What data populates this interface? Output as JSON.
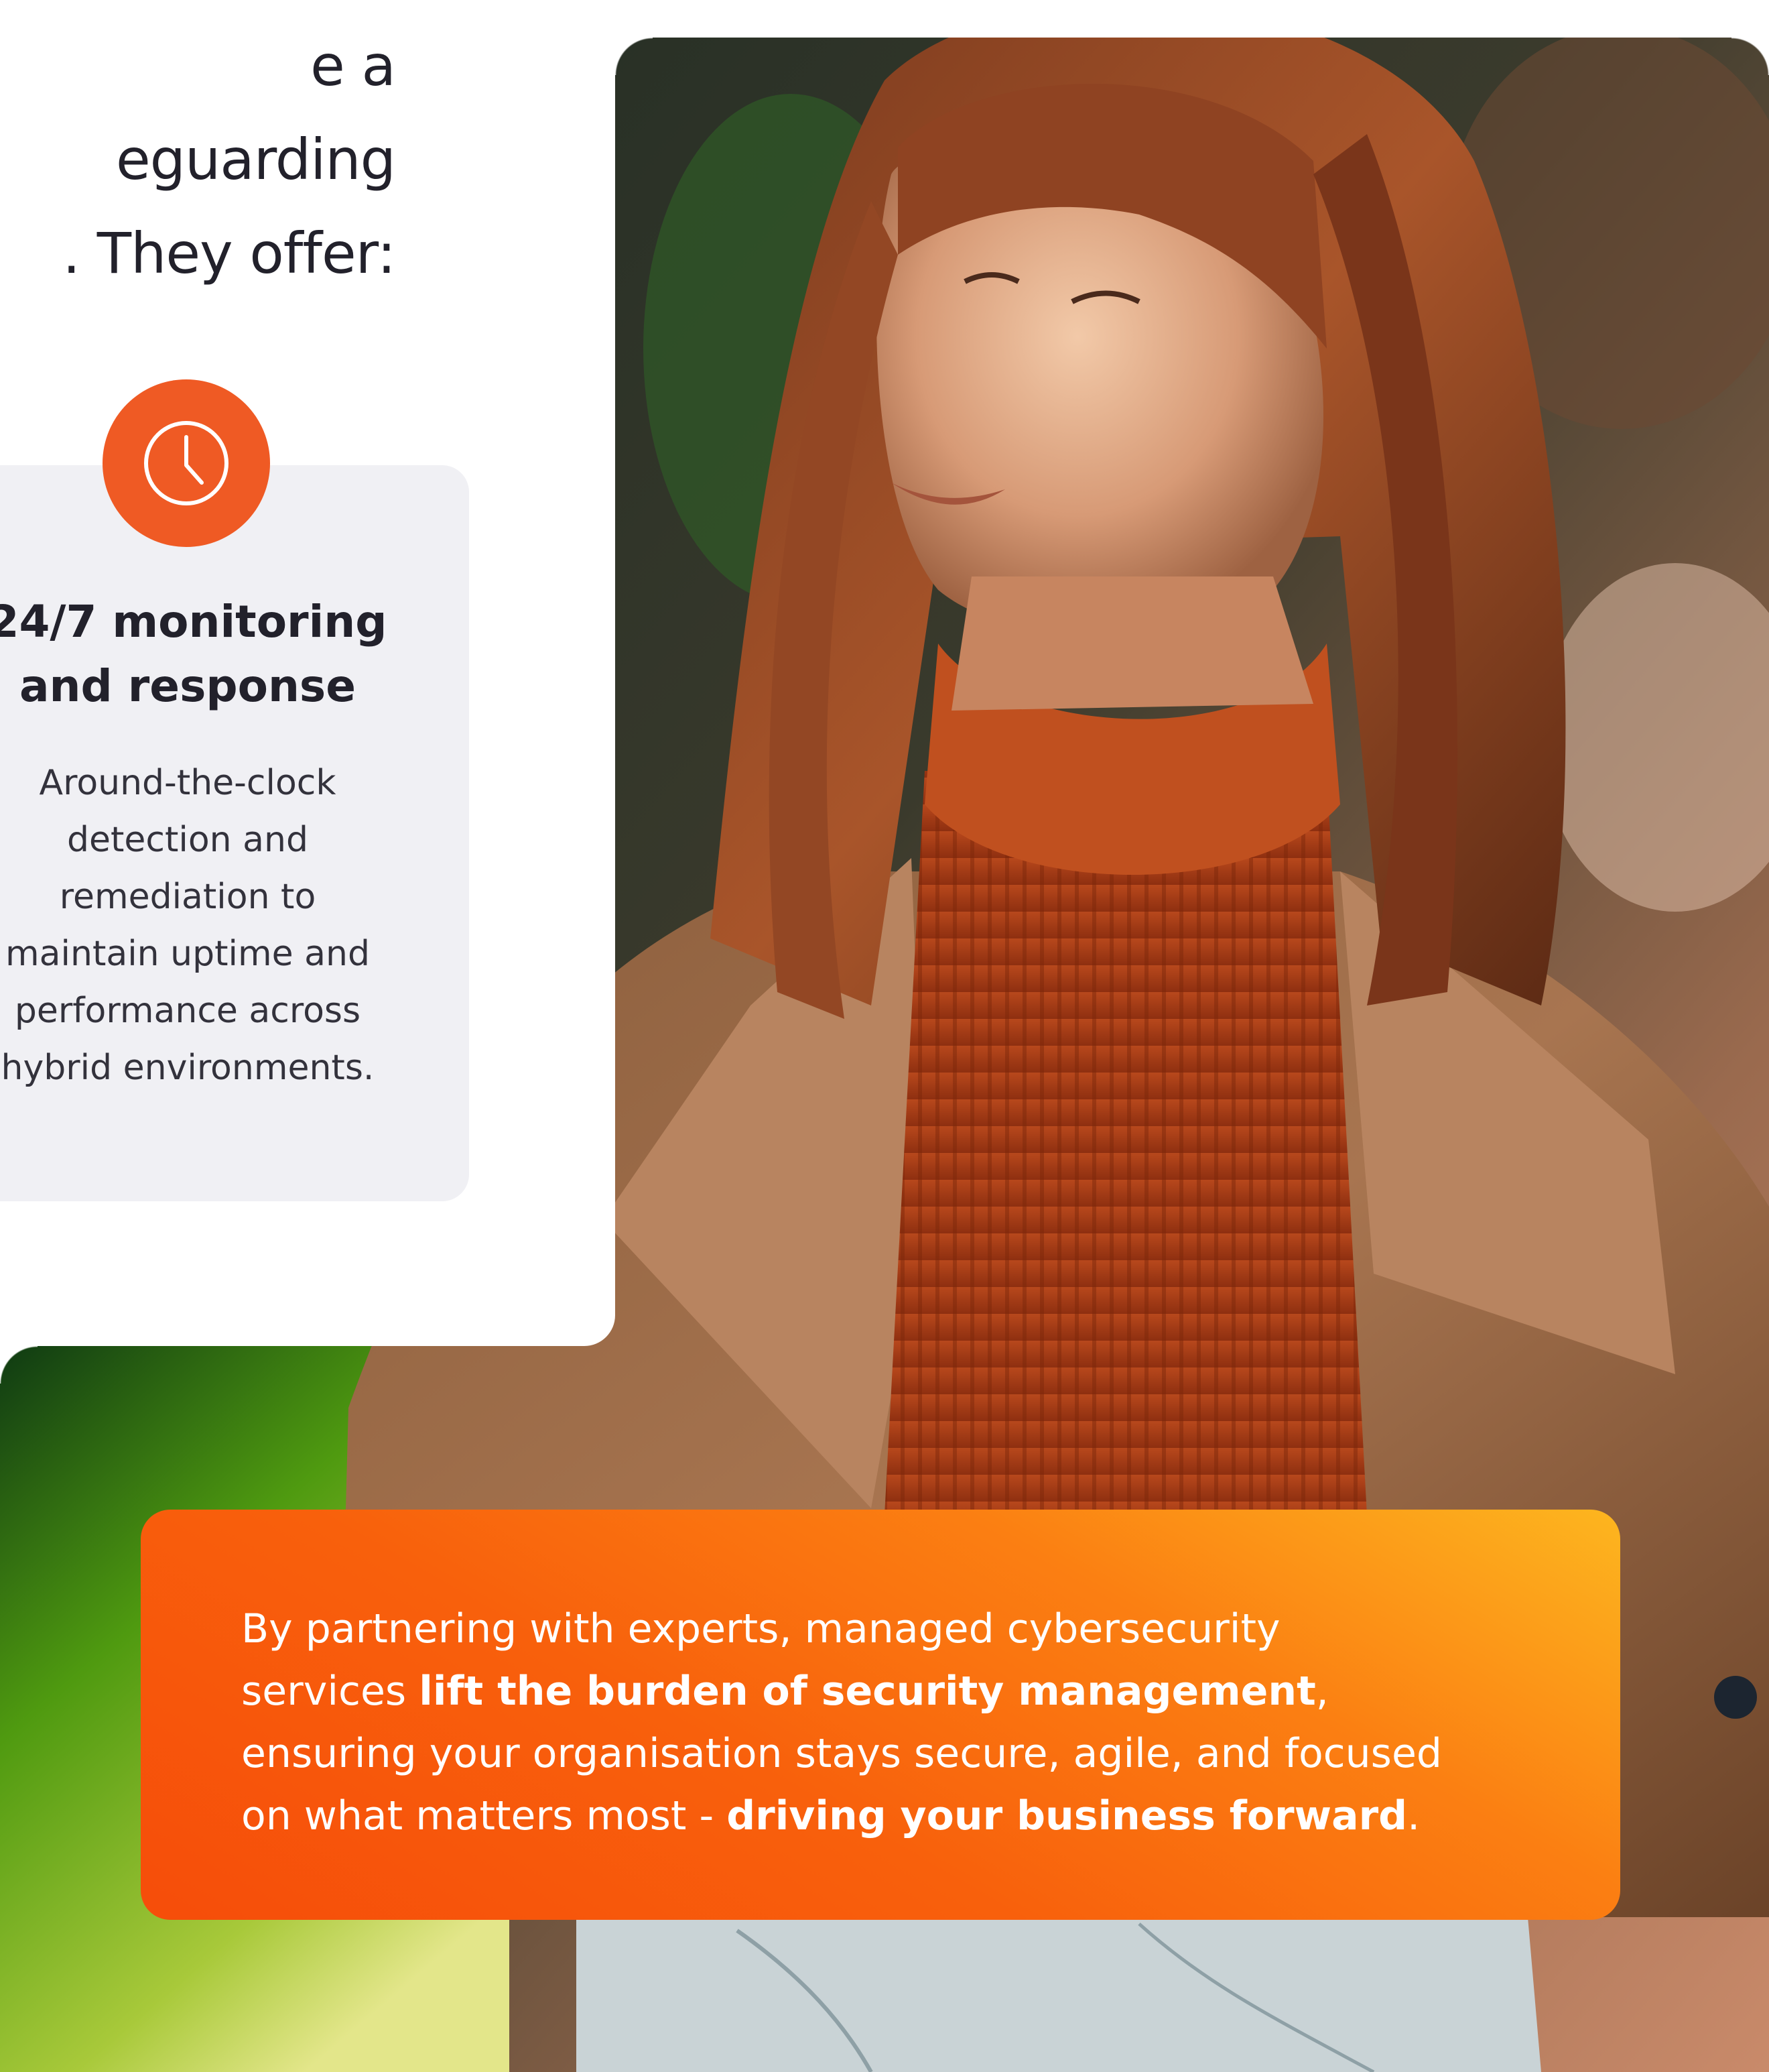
{
  "intro": {
    "line1": "e a",
    "line2": "eguarding",
    "line3": ". They offer:"
  },
  "feature_card": {
    "icon": "clock-icon",
    "title_line1": "24/7 monitoring",
    "title_line2": "and response",
    "body_lines": [
      "Around-the-clock",
      "detection and",
      "remediation to",
      "maintain uptime and",
      "performance across",
      "hybrid environments."
    ]
  },
  "callout": {
    "line1": "By partnering with experts, managed cybersecurity",
    "line2_prefix": "services ",
    "line2_bold": "lift the burden of security management",
    "line2_suffix": ",",
    "line3": "ensuring your organisation stays secure, agile, and focused",
    "line4_prefix": "on what matters most - ",
    "line4_bold": "driving your business forward",
    "line4_suffix": "."
  },
  "colors": {
    "accent_orange": "#ef5a24",
    "card_bg": "#f0f0f4",
    "text_dark": "#22212b",
    "callout_start": "#f64d0a",
    "callout_end": "#fdb61f"
  }
}
